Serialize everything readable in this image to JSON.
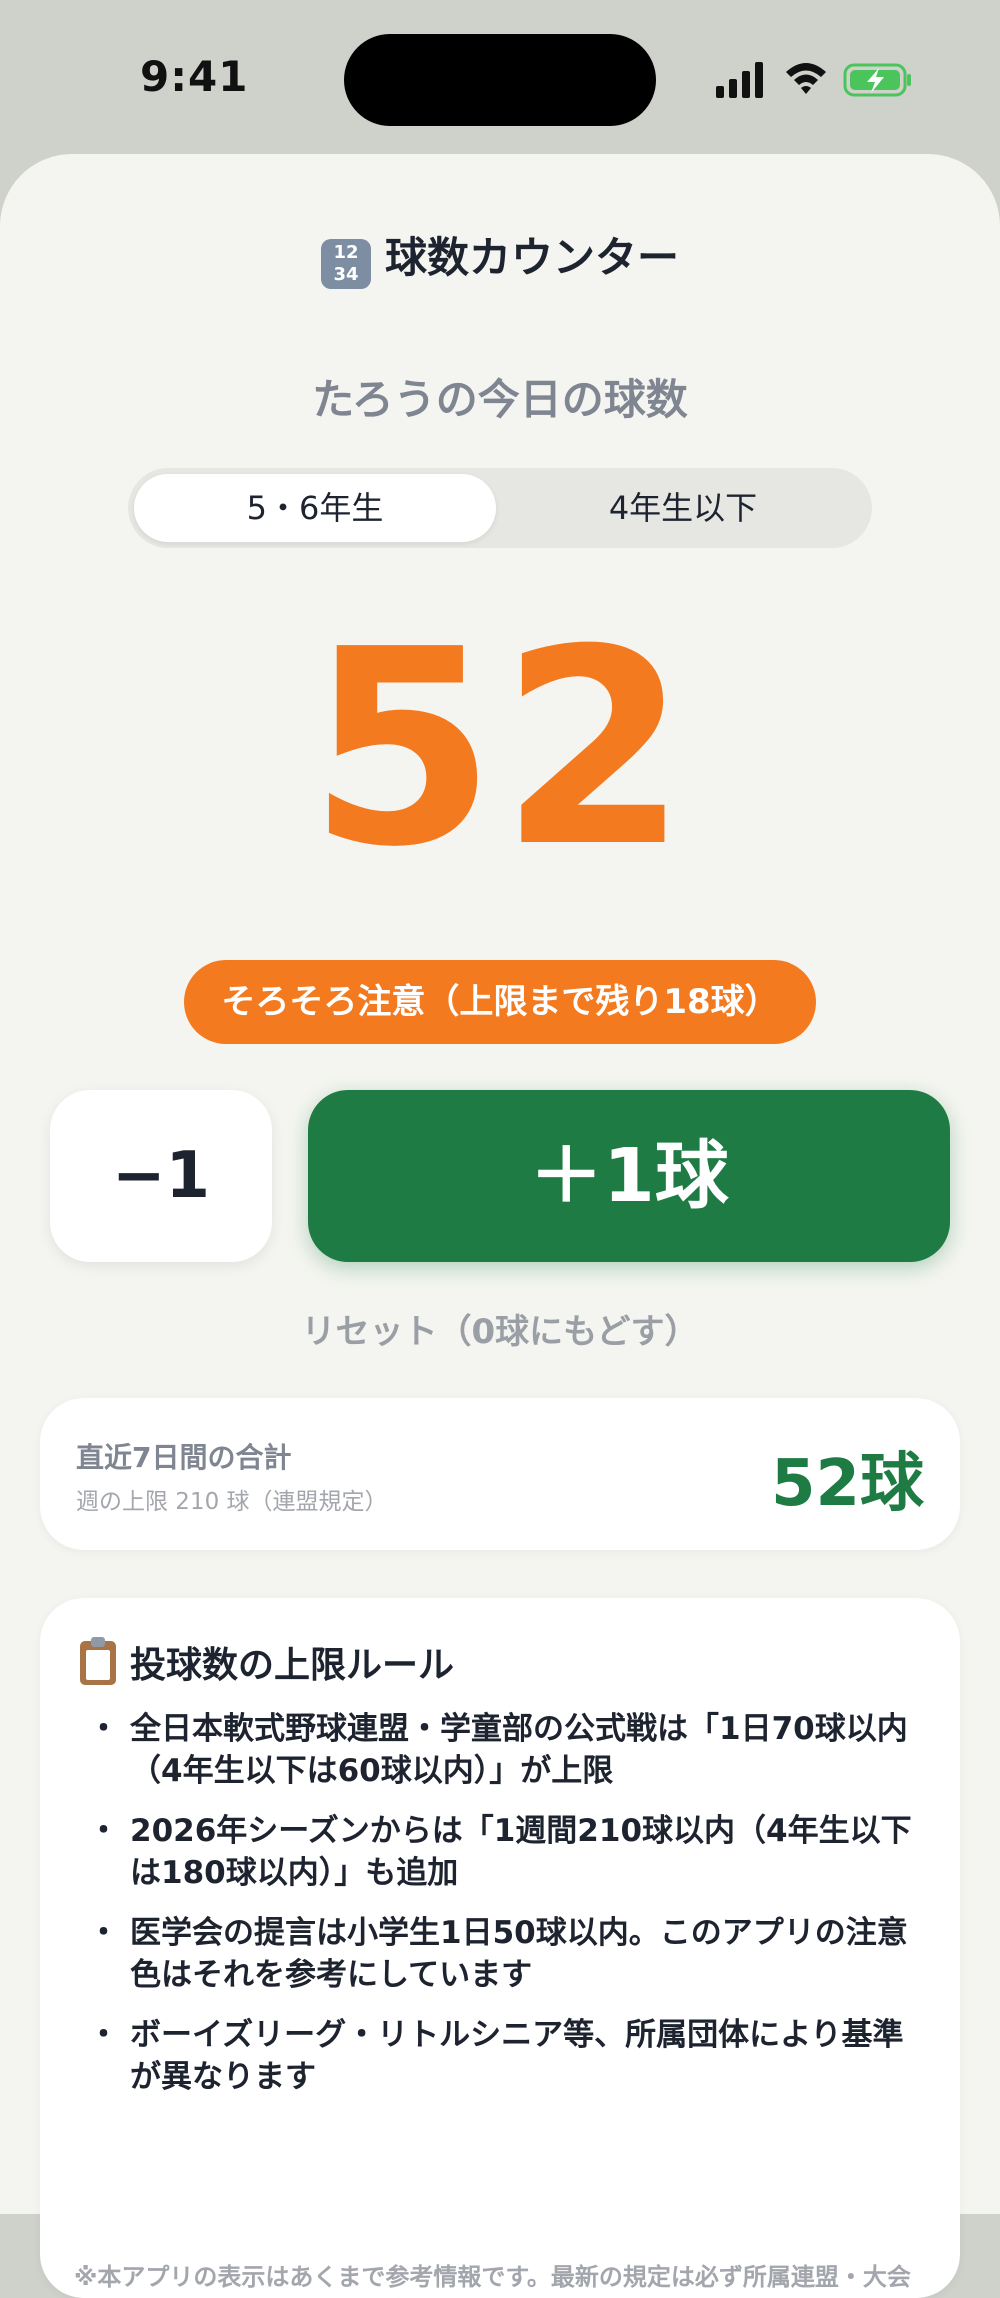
{
  "status_bar": {
    "time": "9:41"
  },
  "app": {
    "title": "球数カウンター",
    "title_icon": "1234-keycap-icon"
  },
  "player": {
    "heading": "たろうの今日の球数"
  },
  "segments": {
    "active": "5・6年生",
    "inactive": "4年生以下"
  },
  "counter": {
    "value": "52",
    "color": "#f47a1f"
  },
  "warning": {
    "text": "そろそろ注意（上限まで残り18球）"
  },
  "buttons": {
    "minus": "−1",
    "plus": "＋1球",
    "reset": "リセット（0球にもどす）"
  },
  "week": {
    "label": "直近7日間の合計",
    "sub": "週の上限 210 球（連盟規定）",
    "total": "52球"
  },
  "rules": {
    "title": "投球数の上限ルール",
    "bullet": "・",
    "items": [
      "全日本軟式野球連盟・学童部の公式戦は「1日70球以内（4年生以下は60球以内）」が上限",
      "2026年シーズンからは「1週間210球以内（4年生以下は180球以内）」も追加",
      "医学会の提言は小学生1日50球以内。このアプリの注意色はそれを参考にしています",
      "ボーイズリーグ・リトルシニア等、所属団体により基準が異なります"
    ],
    "note": "※本アプリの表示はあくまで参考情報です。最新の規定は必ず所属連盟・大会要項をご確認ください。肘や肩に痛みがある場合は、我慢させずに整"
  },
  "colors": {
    "accent_orange": "#f47a1f",
    "accent_green": "#1e7b44"
  }
}
